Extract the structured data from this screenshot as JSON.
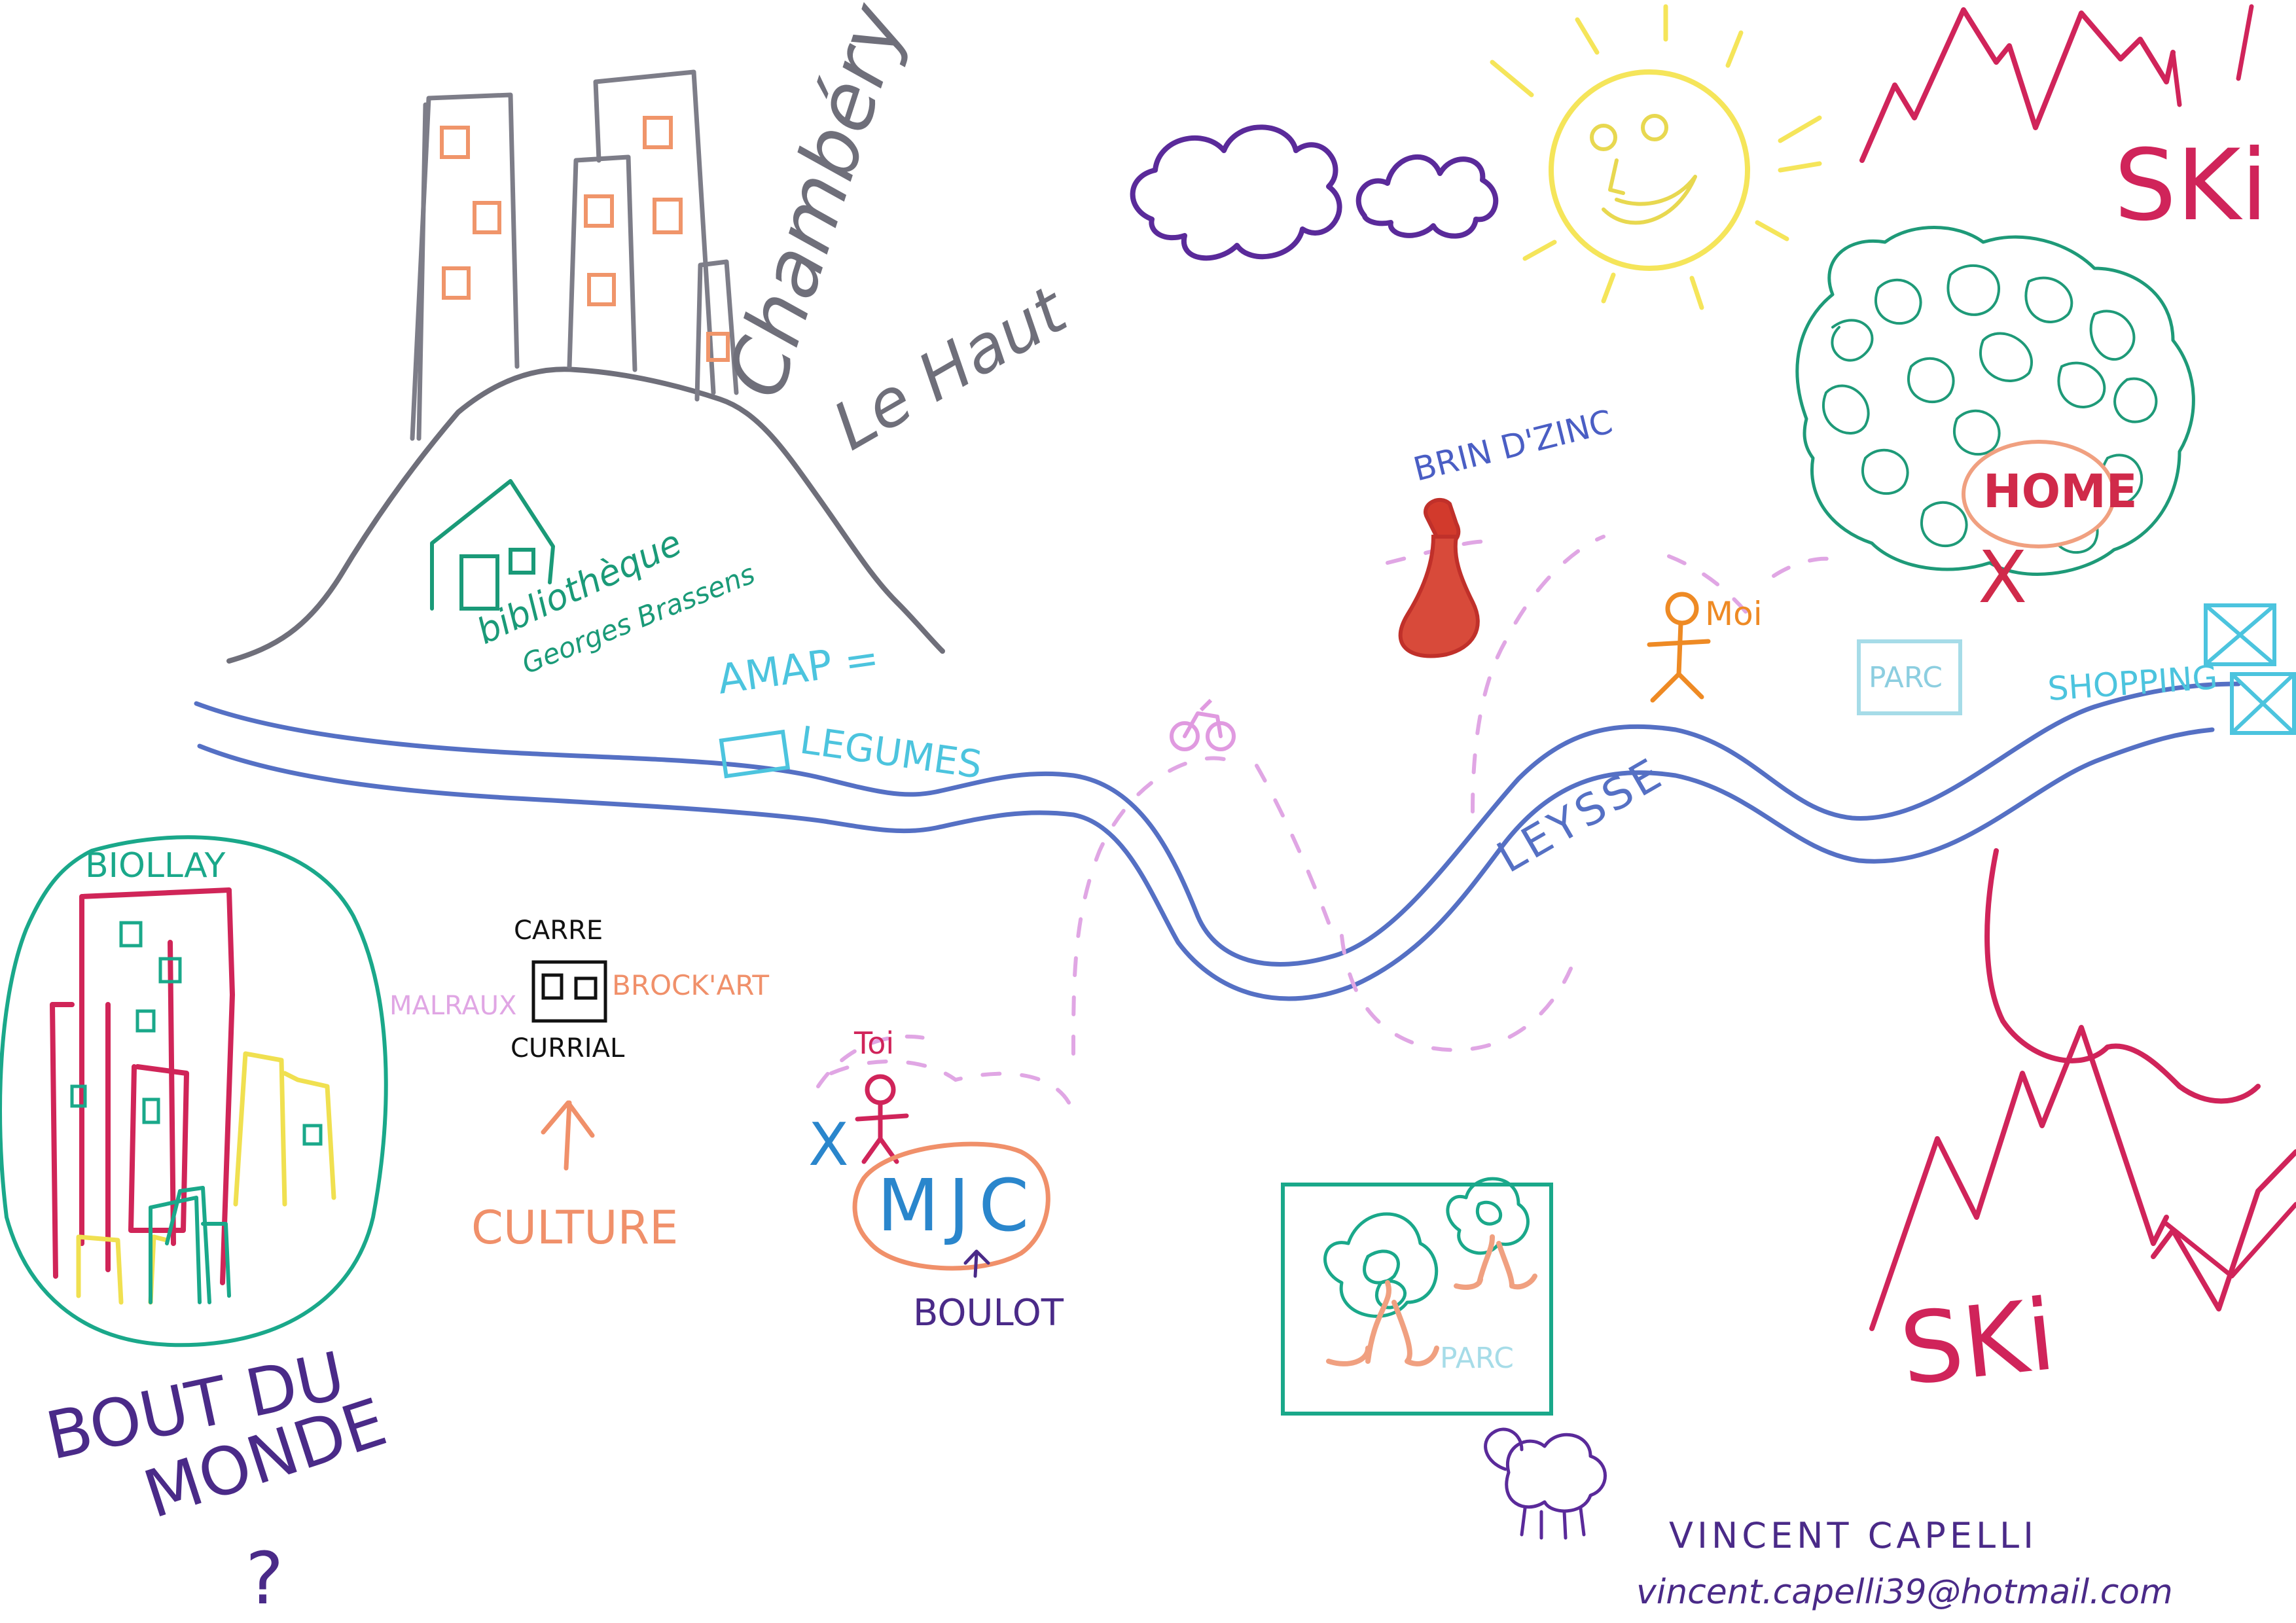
{
  "labels": {
    "city_name": "Chambéry",
    "city_sub": "Le Haut",
    "library_line1": "bibliothèque",
    "library_line2": "Georges Brassens",
    "amap_line1": "AMAP =",
    "amap_line2": "LEGUMES",
    "brin_dzinc": "BRIN D'ZINC",
    "moi": "Moi",
    "home": "HOME",
    "ski_top": "SKi",
    "ski_bottom": "SKi",
    "parc_top": "PARC",
    "shopping": "SHOPPING",
    "river": "LEYSSE",
    "biollay": "BIOLLAY",
    "carre": "CARRE",
    "malraux": "MALRAUX",
    "brockart": "BROCK'ART",
    "currial": "CURRIAL",
    "culture": "CULTURE",
    "toi": "Toi",
    "mjc": "MJC",
    "boulot": "BOULOT",
    "parc_bottom": "PARC",
    "bout_line1": "BOUT DU",
    "bout_line2": "MONDE",
    "bout_line3": "?",
    "author_name": "VINCENT CAPELLI",
    "author_email": "vincent.capelli39@hotmail.com",
    "x_mark": "X"
  },
  "icons": [
    "cloud-icon",
    "sun-icon",
    "bottle-icon",
    "stick-figure-icon",
    "bicycle-icon",
    "tree-icon",
    "sheep-icon",
    "mountain-icon",
    "arrow-icon",
    "house-icon"
  ],
  "colors": {
    "river": "#5570c4",
    "city": "#7d7d88",
    "windows": "#f0956a",
    "library": "#1a9a78",
    "amap": "#4cc4de",
    "wine": "#d23a2c",
    "moi": "#ee8a24",
    "forest": "#1e9a78",
    "home": "#d02a4a",
    "ski": "#d0245a",
    "parc": "#a6dce8",
    "path": "#e0a6e4",
    "biollay": "#1aa88a",
    "biollay_bldg": "#d02558",
    "yellow": "#f0e050",
    "culture": "#f0906a",
    "toi": "#d0245a",
    "mjc": "#2a86cc",
    "mjc_circle": "#f0906a",
    "boulot": "#4a2a88",
    "author": "#4a2a88",
    "cloud": "#5a2a9a",
    "sun": "#f5e55a"
  }
}
